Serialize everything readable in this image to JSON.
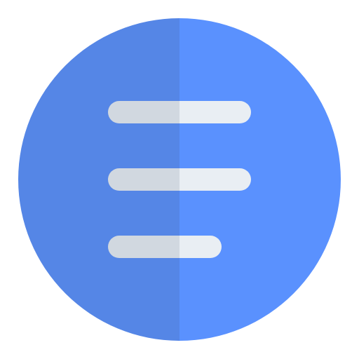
{
  "icon": {
    "name": "menu-icon",
    "colors": {
      "circle_left": "#5586E6",
      "circle_right": "#5A91FE",
      "bar_left": "#D1D8E0",
      "bar_right": "#E9EEF3",
      "background": "#FFFFFF"
    }
  }
}
